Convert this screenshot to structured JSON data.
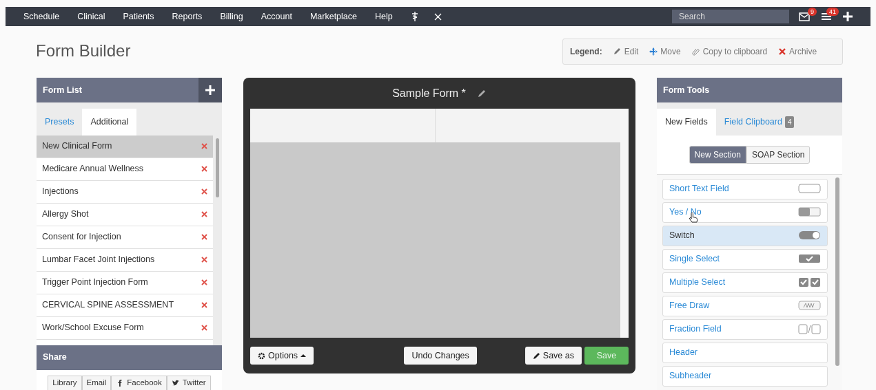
{
  "nav": {
    "items": [
      "Schedule",
      "Clinical",
      "Patients",
      "Reports",
      "Billing",
      "Account",
      "Marketplace",
      "Help"
    ],
    "search": {
      "placeholder": "Search"
    },
    "messages_badge": "9",
    "tasks_badge": "41"
  },
  "page_title": "Form Builder",
  "legend": {
    "label": "Legend:",
    "items": [
      {
        "kind": "edit",
        "text": "Edit"
      },
      {
        "kind": "move",
        "text": "Move"
      },
      {
        "kind": "copy",
        "text": "Copy to clipboard"
      },
      {
        "kind": "archive",
        "text": "Archive"
      }
    ]
  },
  "form_list": {
    "title": "Form List",
    "tabs": [
      {
        "label": "Presets",
        "selected": false
      },
      {
        "label": "Additional",
        "selected": true
      }
    ],
    "items": [
      {
        "name": "New Clinical Form",
        "selected": true
      },
      {
        "name": "Medicare Annual Wellness",
        "selected": false
      },
      {
        "name": "Injections",
        "selected": false
      },
      {
        "name": "Allergy Shot",
        "selected": false
      },
      {
        "name": "Consent for Injection",
        "selected": false
      },
      {
        "name": "Lumbar Facet Joint Injections",
        "selected": false
      },
      {
        "name": "Trigger Point Injection Form",
        "selected": false
      },
      {
        "name": "CERVICAL SPINE ASSESSMENT",
        "selected": false
      },
      {
        "name": "Work/School Excuse Form",
        "selected": false
      }
    ]
  },
  "share": {
    "title": "Share",
    "buttons": [
      {
        "kind": "plain",
        "label": "Library"
      },
      {
        "kind": "plain",
        "label": "Email"
      },
      {
        "kind": "facebook",
        "label": "Facebook"
      },
      {
        "kind": "twitter",
        "label": "Twitter"
      }
    ]
  },
  "editor": {
    "title": "Sample Form *",
    "buttons": {
      "options": "Options",
      "undo": "Undo Changes",
      "save_as": "Save as",
      "save": "Save"
    }
  },
  "form_tools": {
    "title": "Form Tools",
    "tabs": [
      {
        "label": "New Fields",
        "selected": true
      },
      {
        "label": "Field Clipboard",
        "selected": false,
        "badge": "4"
      }
    ],
    "sections": [
      {
        "label": "New Section",
        "selected": true
      },
      {
        "label": "SOAP Section",
        "selected": false
      }
    ],
    "fields": [
      {
        "label": "Short Text Field",
        "kind": "text",
        "selected": false
      },
      {
        "label": "Yes / No",
        "kind": "yesno",
        "selected": false
      },
      {
        "label": "Switch",
        "kind": "switch",
        "selected": true
      },
      {
        "label": "Single Select",
        "kind": "single",
        "selected": false
      },
      {
        "label": "Multiple Select",
        "kind": "multi",
        "selected": false
      },
      {
        "label": "Free Draw",
        "kind": "draw",
        "selected": false
      },
      {
        "label": "Fraction Field",
        "kind": "fraction",
        "selected": false
      },
      {
        "label": "Header",
        "kind": "none",
        "selected": false
      },
      {
        "label": "Subheader",
        "kind": "none",
        "selected": false
      }
    ]
  }
}
